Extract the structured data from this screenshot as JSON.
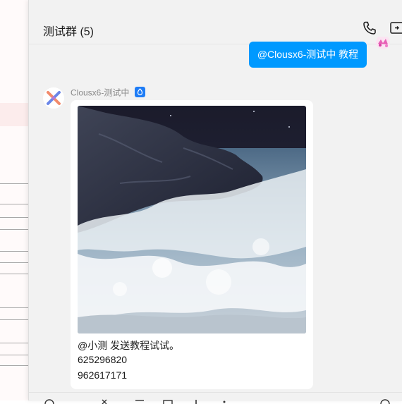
{
  "chat": {
    "title": "测试群 (5)",
    "header_icons": [
      "phone-icon",
      "screen-share-icon"
    ]
  },
  "messages": [
    {
      "direction": "outgoing",
      "text": "@Clousx6-测试中 教程"
    },
    {
      "direction": "incoming",
      "sender": "Clousx6-测试中",
      "badge": "admin-badge",
      "image": "ocean-waves-rock-photo",
      "lines": [
        "@小测 发送教程试试。",
        "625296820",
        "962617171"
      ]
    }
  ],
  "colors": {
    "accent": "#0099ff",
    "panel_bg": "#f2f2f2",
    "bubble_bg": "#ffffff",
    "badge": "#1e7cf6"
  }
}
